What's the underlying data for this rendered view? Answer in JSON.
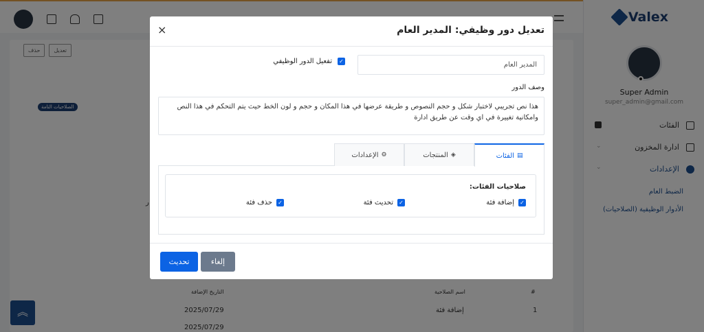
{
  "app": {
    "brand": "Valex"
  },
  "sidebar": {
    "user_name": "Super Admin",
    "user_email": "super_admin@gmail.com",
    "items": [
      {
        "label": "الفئات",
        "icon": "list-icon"
      },
      {
        "label": "ادارة المخزون",
        "icon": "box-icon"
      },
      {
        "label": "الإعدادات",
        "icon": "gear-icon",
        "active": true
      }
    ],
    "sub_items": [
      "الضبط العام",
      "الأدوار الوظيفية (الصلاحيات)"
    ]
  },
  "background": {
    "edit_btn": "تعديل",
    "delete_btn": "حذف",
    "perm_badge": "الصلاحيات التامة",
    "cut_letter": "ﺭ",
    "table_headers": [
      "#",
      "اسم الصلاحية",
      "التاريخ الإضافة"
    ],
    "rows": [
      {
        "num": "1",
        "name": "إضافة فئة",
        "date": "2025/07/29"
      }
    ],
    "partial_date": "2025/07/29"
  },
  "modal": {
    "title": "تعديل دور وظيفي: المدير العام",
    "close_icon": "×",
    "name_value": "المدير العام",
    "activate_label": "تفعيل الدور الوظيفي",
    "activate_checked": true,
    "desc_label": "وصف الدور",
    "desc_value": "هذا نص تجريبي لاختبار شكل و حجم النصوص و طريقة عرضها في هذا المكان و حجم و لون الخط حيث يتم التحكم في هذا النص وامكانية تغييرة في اي وقت عن طريق ادارة",
    "tabs": [
      {
        "label": "الفئات",
        "icon": "list-icon",
        "active": true
      },
      {
        "label": "المنتجات",
        "icon": "cube-icon"
      },
      {
        "label": "الإعدادات",
        "icon": "cogs-icon"
      }
    ],
    "perm_title": "صلاحيات الفئات:",
    "permissions": [
      {
        "label": "إضافة فئة",
        "checked": true
      },
      {
        "label": "تحديث فئة",
        "checked": true
      },
      {
        "label": "حذف فئة",
        "checked": true
      }
    ],
    "update_btn": "تحديث",
    "cancel_btn": "إلغاء"
  },
  "colors": {
    "primary": "#0c63e4",
    "brand": "#1c4e8f",
    "secondary": "#6c7a8d"
  }
}
